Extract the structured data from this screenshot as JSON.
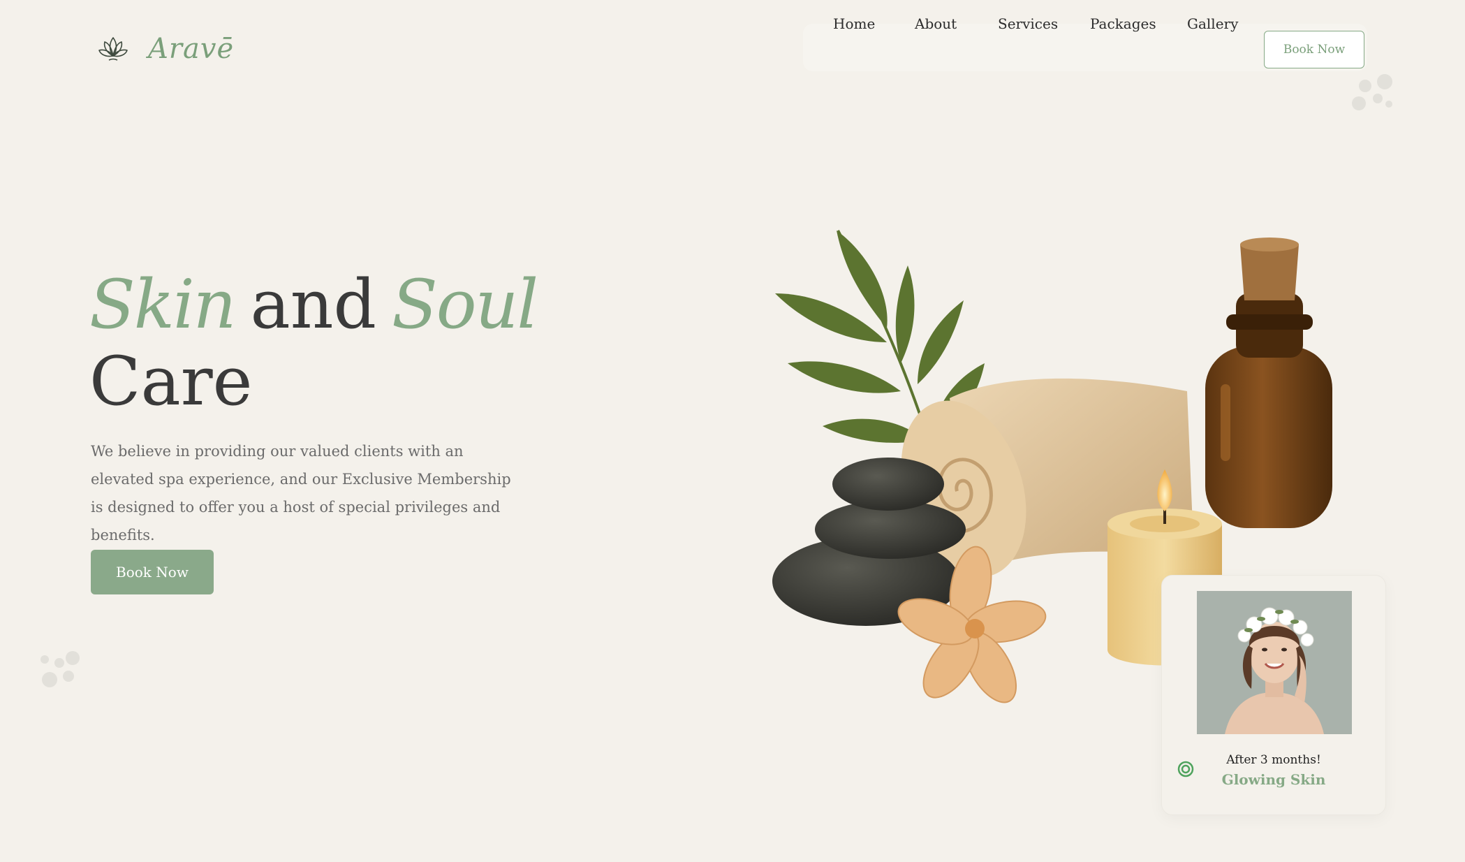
{
  "brand": {
    "name": "Aravē"
  },
  "nav": {
    "items": [
      {
        "label": "Home"
      },
      {
        "label": "About"
      },
      {
        "label": "Services"
      },
      {
        "label": "Packages"
      },
      {
        "label": "Gallery"
      }
    ],
    "book_label": "Book Now"
  },
  "hero": {
    "title_word1": "Skin",
    "title_word2": "and",
    "title_word3": "Soul",
    "title_word4": "Care",
    "description": "We believe in providing our valued clients with an elevated spa experience, and our Exclusive Membership is designed to offer you a host of special privileges and benefits.",
    "button_label": "Book Now"
  },
  "result_card": {
    "subtitle": "After 3 months!",
    "title": "Glowing Skin",
    "icon": "target-icon"
  },
  "colors": {
    "background": "#f4f1eb",
    "accent": "#86a986",
    "button": "#8aa98a",
    "heading": "#3a3a3a",
    "body_text": "#6b6b6b"
  }
}
